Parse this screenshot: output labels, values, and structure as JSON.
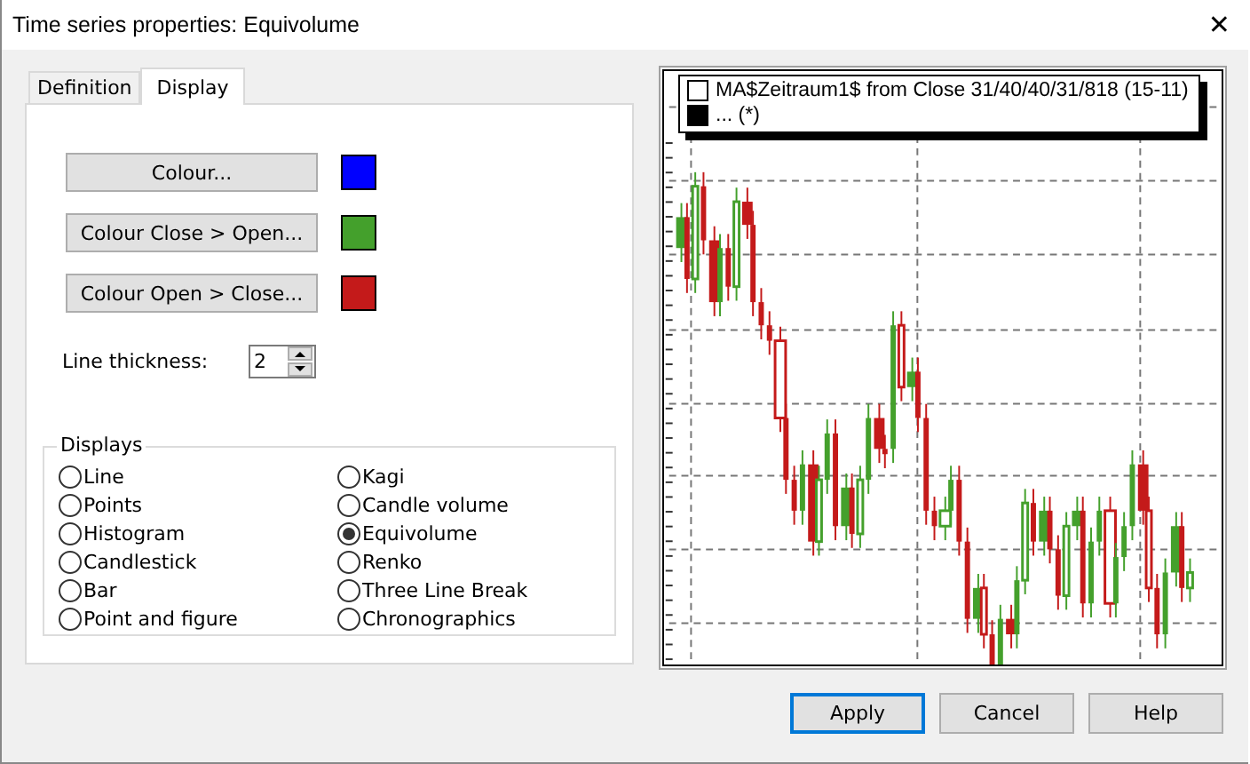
{
  "window": {
    "title": "Time series properties: Equivolume",
    "close": "✕"
  },
  "tabs": [
    {
      "label": "Definition",
      "selected": false
    },
    {
      "label": "Display",
      "selected": true
    }
  ],
  "colour_buttons": [
    {
      "label": "Colour...",
      "color": "#0000ff"
    },
    {
      "label": "Colour Close > Open...",
      "color": "#44a02c"
    },
    {
      "label": "Colour Open > Close...",
      "color": "#c41a1a"
    }
  ],
  "line_thickness": {
    "label": "Line thickness:",
    "value": "2"
  },
  "displays": {
    "title": "Displays",
    "options": [
      {
        "label": "Line",
        "selected": false
      },
      {
        "label": "Points",
        "selected": false
      },
      {
        "label": "Histogram",
        "selected": false
      },
      {
        "label": "Candlestick",
        "selected": false
      },
      {
        "label": "Bar",
        "selected": false
      },
      {
        "label": "Point and figure",
        "selected": false
      },
      {
        "label": "Kagi",
        "selected": false
      },
      {
        "label": "Candle volume",
        "selected": false
      },
      {
        "label": "Equivolume",
        "selected": true
      },
      {
        "label": "Renko",
        "selected": false
      },
      {
        "label": "Three Line Break",
        "selected": false
      },
      {
        "label": "Chronographics",
        "selected": false
      }
    ]
  },
  "preview": {
    "legend": [
      {
        "label": "MA$Zeitraum1$ from Close 31/40/40/31/818 (15-11)",
        "color": "#ffffff"
      },
      {
        "label": "... (*)",
        "color": "#000000"
      }
    ]
  },
  "buttons": [
    {
      "label": "Apply",
      "default": true
    },
    {
      "label": "Cancel",
      "default": false
    },
    {
      "label": "Help",
      "default": false
    }
  ]
}
